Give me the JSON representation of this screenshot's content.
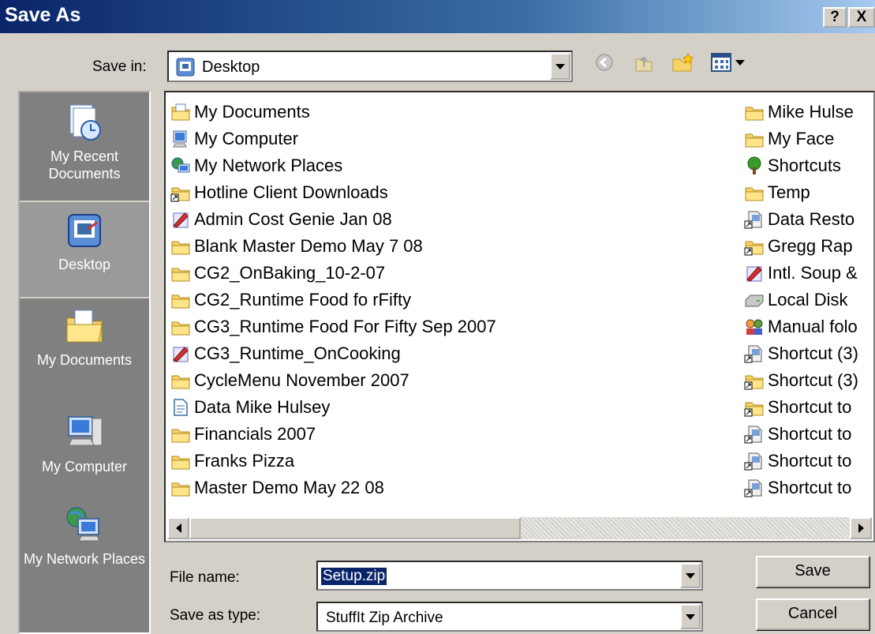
{
  "window": {
    "title": "Save As",
    "help_btn": "?",
    "close_btn": "X"
  },
  "save_in": {
    "label": "Save in:",
    "value": "Desktop"
  },
  "places": [
    {
      "label": "My Recent Documents",
      "icon": "recent-documents-icon"
    },
    {
      "label": "Desktop",
      "icon": "desktop-icon"
    },
    {
      "label": "My Documents",
      "icon": "my-documents-icon"
    },
    {
      "label": "My Computer",
      "icon": "my-computer-icon"
    },
    {
      "label": "My Network Places",
      "icon": "my-network-places-icon"
    }
  ],
  "files_col1": [
    {
      "name": "My Documents",
      "icon": "my-documents-icon"
    },
    {
      "name": "My Computer",
      "icon": "computer-icon"
    },
    {
      "name": "My Network Places",
      "icon": "network-icon"
    },
    {
      "name": "Hotline Client Downloads",
      "icon": "folder-shortcut-icon"
    },
    {
      "name": "Admin Cost Genie Jan 08",
      "icon": "app-icon"
    },
    {
      "name": "Blank Master Demo May 7 08",
      "icon": "folder-icon"
    },
    {
      "name": "CG2_OnBaking_10-2-07",
      "icon": "folder-icon"
    },
    {
      "name": "CG2_Runtime Food fo rFifty",
      "icon": "folder-icon"
    },
    {
      "name": "CG3_Runtime Food For Fifty Sep 2007",
      "icon": "folder-icon"
    },
    {
      "name": "CG3_Runtime_OnCooking",
      "icon": "app-icon"
    },
    {
      "name": "CycleMenu November 2007",
      "icon": "folder-icon"
    },
    {
      "name": "Data Mike Hulsey",
      "icon": "document-icon"
    },
    {
      "name": "Financials 2007",
      "icon": "folder-icon"
    },
    {
      "name": "Franks Pizza",
      "icon": "folder-icon"
    },
    {
      "name": "Master Demo May 22 08",
      "icon": "folder-icon"
    }
  ],
  "files_col2": [
    {
      "name": "Mike Hulse",
      "icon": "folder-icon"
    },
    {
      "name": "My Face",
      "icon": "folder-icon"
    },
    {
      "name": "Shortcuts",
      "icon": "tree-icon"
    },
    {
      "name": "Temp",
      "icon": "folder-icon"
    },
    {
      "name": "Data Resto",
      "icon": "shortcut-icon"
    },
    {
      "name": "Gregg Rap",
      "icon": "folder-shortcut-icon"
    },
    {
      "name": "Intl. Soup &",
      "icon": "app-icon"
    },
    {
      "name": "Local Disk",
      "icon": "disk-icon"
    },
    {
      "name": "Manual folo",
      "icon": "users-icon"
    },
    {
      "name": "Shortcut (3)",
      "icon": "shortcut-icon"
    },
    {
      "name": "Shortcut (3)",
      "icon": "folder-shortcut-icon"
    },
    {
      "name": "Shortcut to",
      "icon": "folder-shortcut-icon"
    },
    {
      "name": "Shortcut to",
      "icon": "shortcut-icon"
    },
    {
      "name": "Shortcut to",
      "icon": "shortcut-icon"
    },
    {
      "name": "Shortcut to",
      "icon": "shortcut-icon"
    }
  ],
  "file_name": {
    "label": "File name:",
    "value": "Setup.zip"
  },
  "save_type": {
    "label": "Save as type:",
    "value": "StuffIt Zip Archive"
  },
  "buttons": {
    "save": "Save",
    "cancel": "Cancel"
  }
}
